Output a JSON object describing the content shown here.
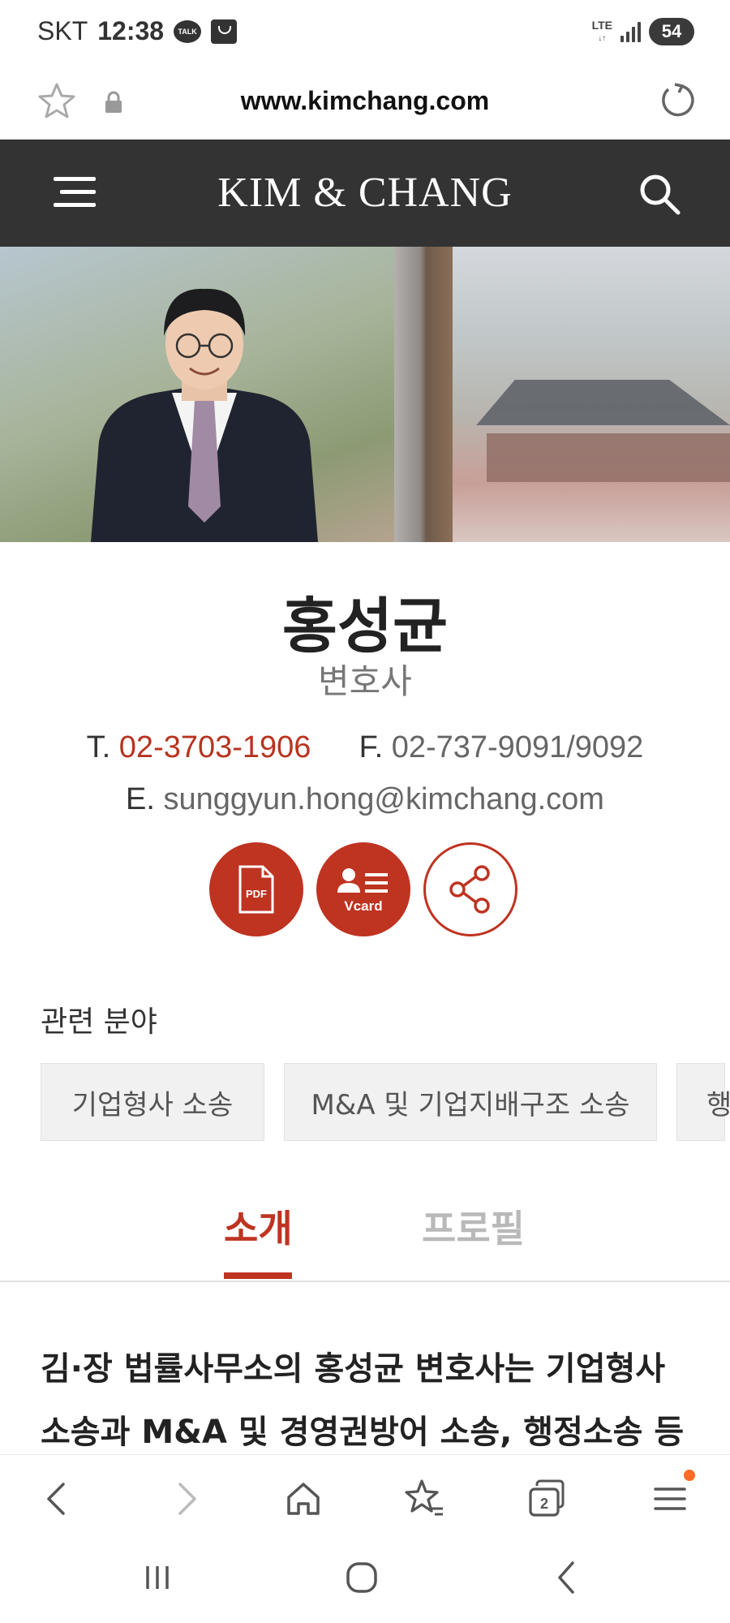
{
  "status_bar": {
    "carrier": "SKT",
    "time": "12:38",
    "talk_badge": "TALK",
    "network": "LTE",
    "battery": "54"
  },
  "browser": {
    "url": "www.kimchang.com"
  },
  "site": {
    "logo": "KIM & CHANG"
  },
  "profile": {
    "name": "홍성균",
    "title": "변호사",
    "phone_label": "T.",
    "phone": "02-3703-1906",
    "fax_label": "F.",
    "fax": "02-737-9091/9092",
    "email_label": "E.",
    "email": "sunggyun.hong@kimchang.com"
  },
  "actions": {
    "pdf_label": "PDF",
    "vcard_label": "Vcard"
  },
  "related": {
    "label": "관련 분야",
    "chips": [
      "기업형사 소송",
      "M&A 및 기업지배구조 소송",
      "행"
    ]
  },
  "tabs": [
    {
      "label": "소개"
    },
    {
      "label": "프로필"
    }
  ],
  "intro_text": "김·장 법률사무소의 홍성균 변호사는 기업형사 소송과 M&A 및 경영권방어 소송, 행정소송 등 업무",
  "colors": {
    "accent": "#bf3321",
    "header_bg": "#333333"
  },
  "icons": {
    "toolbar": [
      "back-icon",
      "forward-icon",
      "home-icon",
      "bookmarks-icon",
      "tabs-icon",
      "menu-icon"
    ],
    "nav": [
      "recents-icon",
      "home-circle-icon",
      "back-nav-icon"
    ]
  },
  "toolbar": {
    "tab_count": "2"
  }
}
